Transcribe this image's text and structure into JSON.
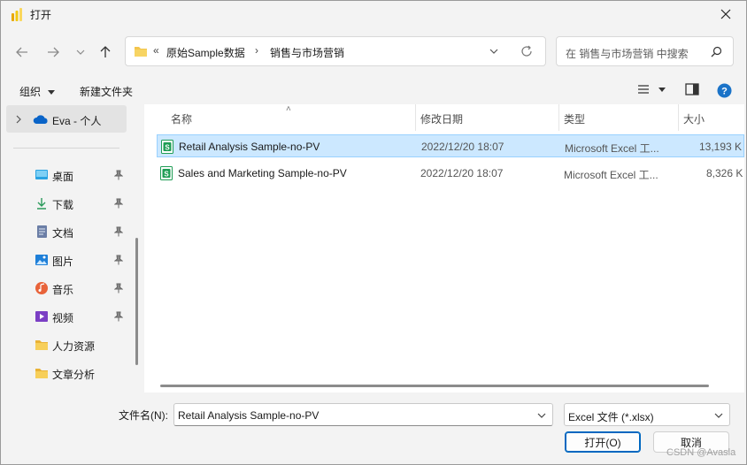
{
  "window": {
    "title": "打开"
  },
  "address": {
    "overflow": "«",
    "crumbs": [
      "原始Sample数据",
      "销售与市场营销"
    ]
  },
  "search": {
    "placeholder": "在 销售与市场营销 中搜索"
  },
  "toolbar": {
    "organize": "组织",
    "new_folder": "新建文件夹"
  },
  "sidebar": {
    "top": {
      "label": "Eva - 个人"
    },
    "items": [
      {
        "label": "桌面",
        "icon": "desktop-icon",
        "pinned": true
      },
      {
        "label": "下载",
        "icon": "download-icon",
        "pinned": true
      },
      {
        "label": "文档",
        "icon": "document-icon",
        "pinned": true
      },
      {
        "label": "图片",
        "icon": "pictures-icon",
        "pinned": true
      },
      {
        "label": "音乐",
        "icon": "music-icon",
        "pinned": true
      },
      {
        "label": "视频",
        "icon": "video-icon",
        "pinned": true
      },
      {
        "label": "人力资源",
        "icon": "folder-icon",
        "pinned": false
      },
      {
        "label": "文章分析",
        "icon": "folder-icon",
        "pinned": false
      }
    ]
  },
  "columns": {
    "name": "名称",
    "date": "修改日期",
    "type": "类型",
    "size": "大小"
  },
  "files": [
    {
      "name": "Retail Analysis Sample-no-PV",
      "date": "2022/12/20 18:07",
      "type": "Microsoft Excel 工...",
      "size": "13,193 K",
      "selected": true
    },
    {
      "name": "Sales and Marketing Sample-no-PV",
      "date": "2022/12/20 18:07",
      "type": "Microsoft Excel 工...",
      "size": "8,326 K",
      "selected": false
    }
  ],
  "footer": {
    "filename_label": "文件名(N):",
    "filename_value": "Retail Analysis Sample-no-PV",
    "filetype": "Excel 文件 (*.xlsx)",
    "open": "打开(O)",
    "cancel": "取消"
  },
  "watermark": "CSDN @Avasla",
  "colors": {
    "accent": "#0067c0",
    "selection": "#cce8ff",
    "folder": "#f3c54d",
    "excel": "#1f9d55"
  }
}
